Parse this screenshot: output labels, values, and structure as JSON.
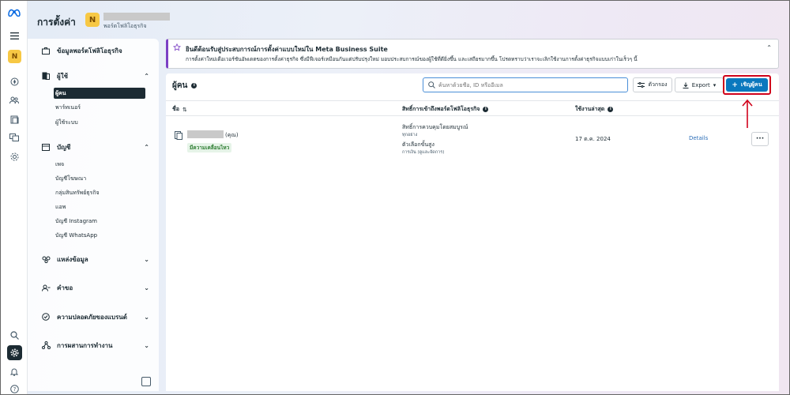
{
  "app": {
    "title": "การตั้งค่า",
    "account_initial": "N",
    "account_subtitle": "พอร์ตโฟลิโอธุรกิจ"
  },
  "rail": {
    "avatar_initial": "N",
    "icons": [
      "meta-logo-icon",
      "menu-icon",
      "home-icon",
      "people-icon",
      "pages-icon",
      "catalog-icon",
      "settings-icon",
      "search-icon",
      "gear-icon",
      "bell-icon",
      "help-icon"
    ]
  },
  "nav": {
    "business_info": "ข้อมูลพอร์ตโฟลิโอธุรกิจ",
    "users_section": "ผู้ใช้",
    "users_items": [
      "ผู้คน",
      "พาร์ทเนอร์",
      "ผู้ใช้ระบบ"
    ],
    "accounts_section": "บัญชี",
    "accounts_items": [
      "เพจ",
      "บัญชีโฆษณา",
      "กลุ่มสินทรัพย์ธุรกิจ",
      "แอพ",
      "บัญชี Instagram",
      "บัญชี WhatsApp"
    ],
    "data_sources": "แหล่งข้อมูล",
    "requests": "คำขอ",
    "brand_safety": "ความปลอดภัยของแบรนด์",
    "integrations": "การผสานการทำงาน"
  },
  "banner": {
    "title": "ยินดีต้อนรับสู่ประสบการณ์การตั้งค่าแบบใหม่ใน Meta Business Suite",
    "body": "การตั้งค่าใหม่เดือเวอร์ชันอัพเดตของการตั้งค่าธุรกิจ ซึ่งมีฟีเจอร์เหมือนกันแต่ปรับปรุงใหม่ มอบประสบการณ์ของผู้ใช้ที่ดียิ่งขึ้น และเสถียรมากขึ้น โปรดทราบว่าเราจะเลิกใช้งานการตั้งค่าธุรกิจแบบเก่าในเร็วๆ นี้"
  },
  "panel": {
    "title": "ผู้คน",
    "search_placeholder": "ค้นหาด้วยชื่อ, ID หรืออีเมล",
    "filter_label": "ตัวกรอง",
    "export_label": "Export",
    "invite_label": "เชิญผู้คน"
  },
  "table": {
    "headers": {
      "name": "ชื่อ",
      "access": "สิทธิ์การเข้าถึงพอร์ตโฟลิโอธุรกิจ",
      "last_active": "ใช้งานล่าสุด"
    },
    "rows": [
      {
        "name_suffix": "(คุณ)",
        "badge": "มีความเคลื่อนไหว",
        "perm_title": "สิทธิ์การควบคุมโดยสมบูรณ์",
        "perm_title_sub": "ทุกอย่าง",
        "perm_option": "ตัวเลือกขั้นสูง",
        "perm_option_sub": "การเงิน (ดูและจัดการ)",
        "last_active": "17 ต.ค. 2024",
        "details_label": "Details",
        "more_label": "···"
      }
    ]
  },
  "colors": {
    "primary": "#0a78be",
    "highlight": "#d0021b",
    "banner_accent": "#7b3fc4",
    "active_badge_bg": "#e6f4e8"
  }
}
